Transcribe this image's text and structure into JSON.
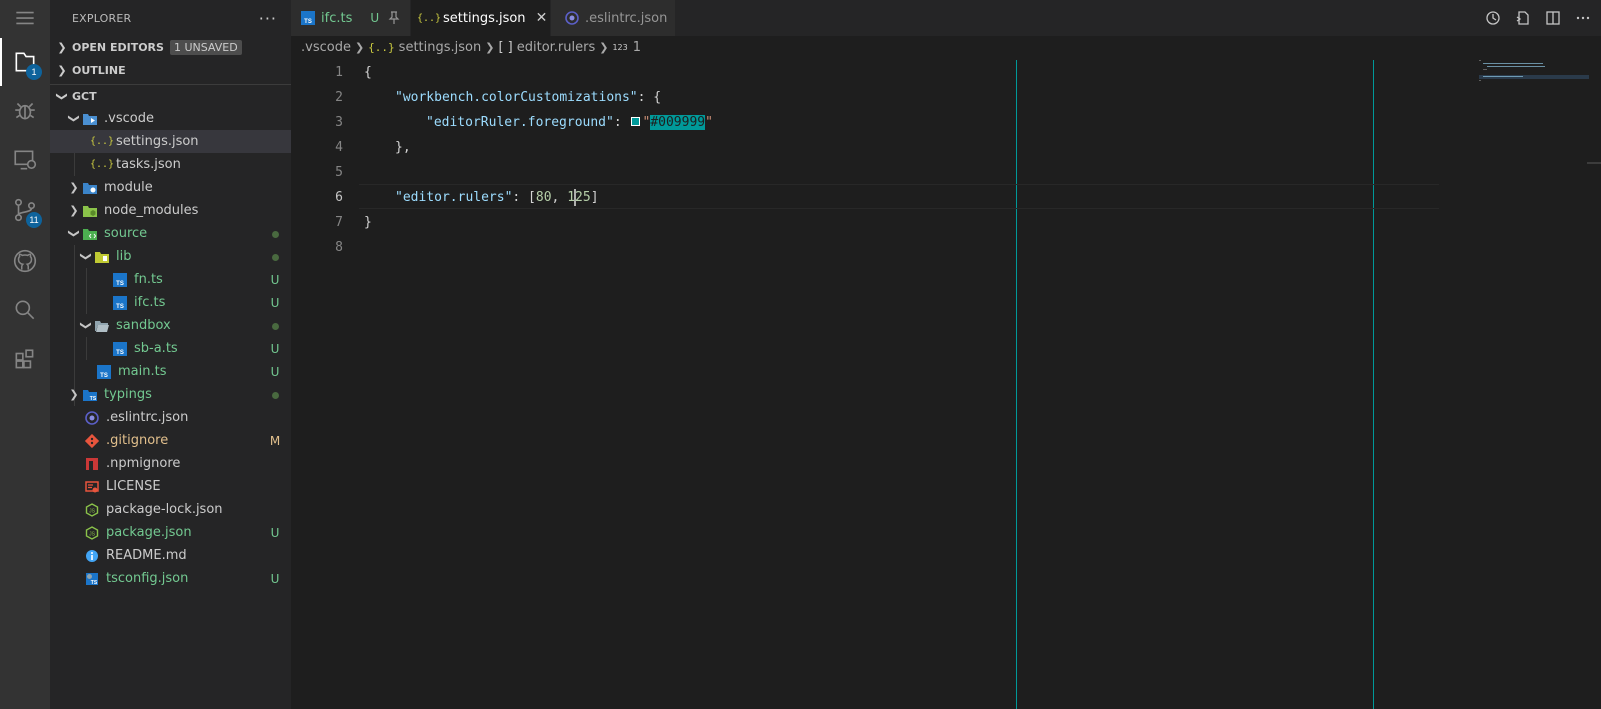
{
  "sidebar": {
    "title": "EXPLORER",
    "more": "···",
    "open_editors": "OPEN EDITORS",
    "unsaved_badge": "1 UNSAVED",
    "outline": "OUTLINE",
    "folder": "GCT",
    "tree": [
      {
        "label": ".vscode",
        "status": ""
      },
      {
        "label": "settings.json",
        "status": ""
      },
      {
        "label": "tasks.json",
        "status": ""
      },
      {
        "label": "module",
        "status": ""
      },
      {
        "label": "node_modules",
        "status": ""
      },
      {
        "label": "source",
        "status": ""
      },
      {
        "label": "lib",
        "status": ""
      },
      {
        "label": "fn.ts",
        "status": "U"
      },
      {
        "label": "ifc.ts",
        "status": "U"
      },
      {
        "label": "sandbox",
        "status": ""
      },
      {
        "label": "sb-a.ts",
        "status": "U"
      },
      {
        "label": "main.ts",
        "status": "U"
      },
      {
        "label": "typings",
        "status": ""
      },
      {
        "label": ".eslintrc.json",
        "status": ""
      },
      {
        "label": ".gitignore",
        "status": "M"
      },
      {
        "label": ".npmignore",
        "status": ""
      },
      {
        "label": "LICENSE",
        "status": ""
      },
      {
        "label": "package-lock.json",
        "status": ""
      },
      {
        "label": "package.json",
        "status": "U"
      },
      {
        "label": "README.md",
        "status": ""
      },
      {
        "label": "tsconfig.json",
        "status": "U"
      }
    ]
  },
  "activity": {
    "explorer_badge": "1",
    "scm_badge": "11"
  },
  "tabs": [
    {
      "label": "ifc.ts",
      "status": "U"
    },
    {
      "label": "settings.json",
      "close": "✕"
    },
    {
      "label": ".eslintrc.json"
    }
  ],
  "breadcrumb": {
    "folder": ".vscode",
    "file_icon": "{..}",
    "file": "settings.json",
    "key_icon": "[ ]",
    "key": "editor.rulers",
    "num_icon": "123",
    "num": "1"
  },
  "editor": {
    "line_numbers": [
      "1",
      "2",
      "3",
      "4",
      "5",
      "6",
      "7",
      "8"
    ],
    "current_line": 6,
    "lines": {
      "l1": "{",
      "l2_key": "\"workbench.colorCustomizations\"",
      "l2_rest": ": {",
      "l3_key": "\"editorRuler.foreground\"",
      "l3_colon": ": ",
      "l3_q1": "\"",
      "l3_val": "#009999",
      "l3_q2": "\"",
      "l4": "},",
      "l6_key": "\"editor.rulers\"",
      "l6_a": ": [",
      "l6_n1": "80",
      "l6_b": ", ",
      "l6_n2a": "1",
      "l6_n2b": "25",
      "l6_c": "]",
      "l7": "}"
    },
    "ruler_color": "#009999",
    "rulers": [
      80,
      125
    ]
  },
  "colors": {
    "accent": "#0e639c",
    "untracked": "#73c991",
    "modified": "#e2c08d",
    "ruler": "#009999"
  }
}
